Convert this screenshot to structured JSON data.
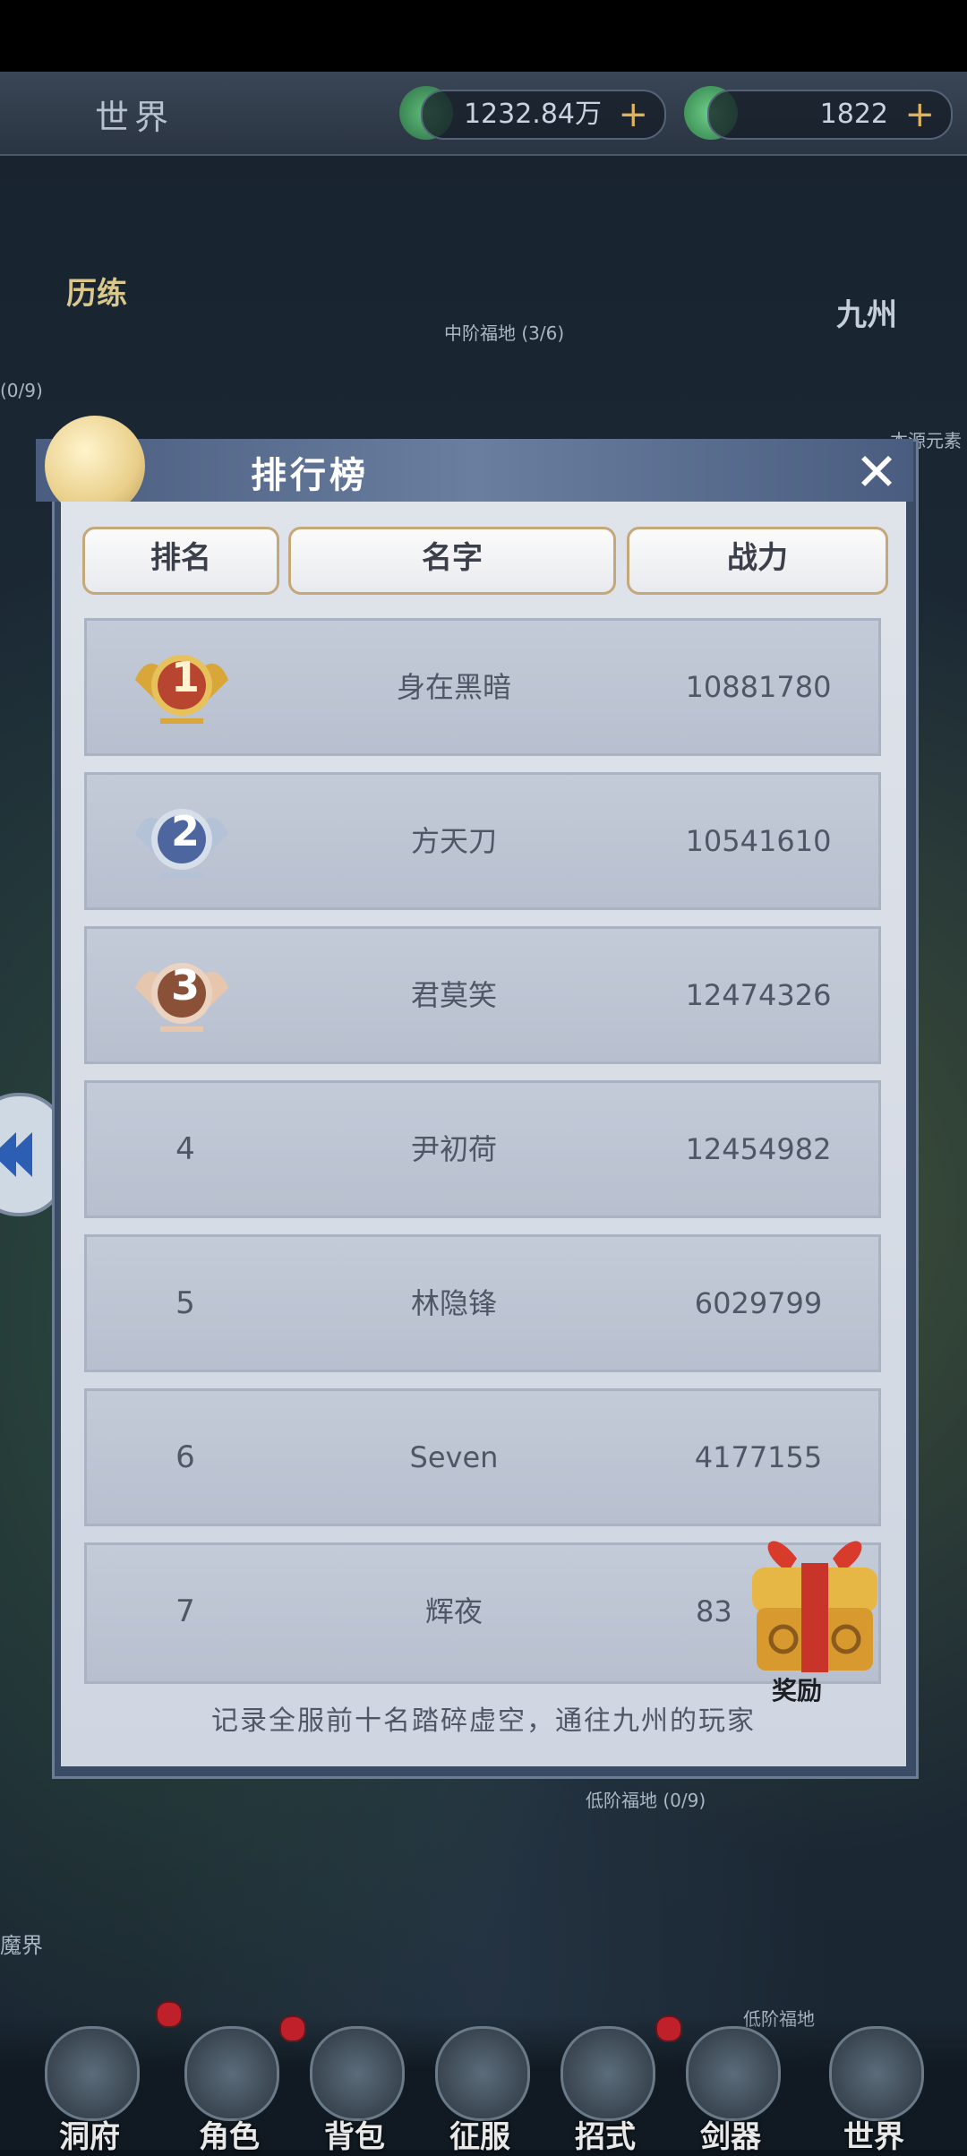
{
  "top_bar": {
    "title": "世界",
    "jade_value": "1232.84万",
    "token_value": "1822",
    "plus": "+"
  },
  "map_labels": {
    "trial": "历练",
    "mid_land": "中阶福地 (3/6)",
    "left_count": "(0/9)",
    "jiuzhou": "九州",
    "right_text": "本源元素",
    "low_land": "低阶福地 (0/9)",
    "realm": "魔界",
    "low_land_2": "低阶福地"
  },
  "modal": {
    "title": "排行榜",
    "close_symbol": "✕",
    "headers": [
      "排名",
      "名字",
      "战力"
    ],
    "footer": "记录全服前十名踏碎虚空，通往九州的玩家",
    "reward_label": "奖励"
  },
  "ranking": [
    {
      "rank": "1",
      "name": "身在黑暗",
      "power": "10881780",
      "medal": "gold"
    },
    {
      "rank": "2",
      "name": "方天刀",
      "power": "10541610",
      "medal": "silver"
    },
    {
      "rank": "3",
      "name": "君莫笑",
      "power": "12474326",
      "medal": "bronze"
    },
    {
      "rank": "4",
      "name": "尹初荷",
      "power": "12454982"
    },
    {
      "rank": "5",
      "name": "林隐锋",
      "power": "6029799"
    },
    {
      "rank": "6",
      "name": "Seven",
      "power": "4177155"
    },
    {
      "rank": "7",
      "name": "辉夜",
      "power": "83"
    }
  ],
  "nav": [
    "洞府",
    "角色",
    "背包",
    "征服",
    "招式",
    "剑器",
    "世界"
  ],
  "colors": {
    "gold": "#d9a63a",
    "silver": "#5f76a8",
    "bronze": "#9a5d3c",
    "badge_red": "#c0202a"
  }
}
